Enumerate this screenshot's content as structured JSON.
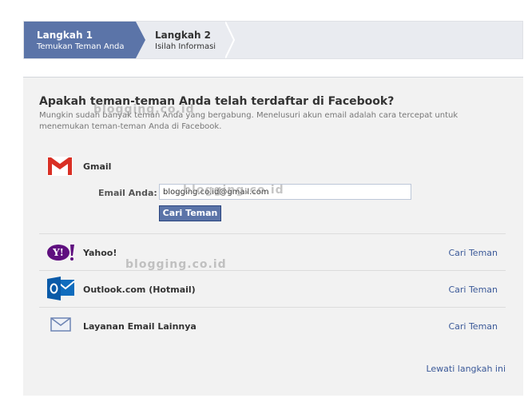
{
  "steps": [
    {
      "title": "Langkah 1",
      "subtitle": "Temukan Teman Anda",
      "active": true
    },
    {
      "title": "Langkah 2",
      "subtitle": "Isilah Informasi",
      "active": false
    }
  ],
  "heading": "Apakah teman-teman Anda telah terdaftar di Facebook?",
  "description": "Mungkin sudah banyak teman Anda yang bergabung. Menelusuri akun email adalah cara tercepat untuk menemukan teman-teman Anda di Facebook.",
  "gmail": {
    "name": "Gmail",
    "email_label": "Email Anda:",
    "email_value": "blogging.co.id@gmail.com",
    "button_label": "Cari Teman",
    "icon": "gmail-icon"
  },
  "providers": [
    {
      "name": "Yahoo!",
      "link": "Cari Teman",
      "icon": "yahoo-icon"
    },
    {
      "name": "Outlook.com (Hotmail)",
      "link": "Cari Teman",
      "icon": "outlook-icon"
    },
    {
      "name": "Layanan Email Lainnya",
      "link": "Cari Teman",
      "icon": "envelope-icon"
    }
  ],
  "skip_link": "Lewati langkah ini",
  "watermark": "blogging.co.id",
  "colors": {
    "accent": "#5b74a8",
    "link": "#3b5998",
    "panel": "#f2f2f2"
  }
}
